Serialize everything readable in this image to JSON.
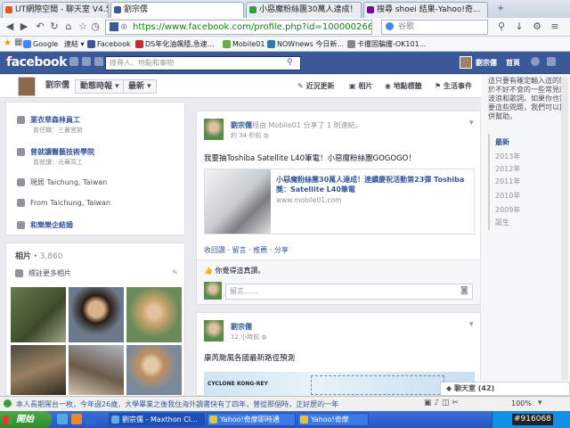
{
  "browser": {
    "tabs": [
      {
        "label": "UT網際空間 - 聊天室 V4.5",
        "color": "#e05a1f"
      },
      {
        "label": "劉宗儒",
        "color": "#3b5998"
      },
      {
        "label": "小惡魔粉絲團30萬人達成！",
        "color": "#3a9d3a"
      },
      {
        "label": "搜尋 shoei 結果-Yahoo!奇...",
        "color": "#7b0099"
      }
    ],
    "url": "https://www.facebook.com/profile.php?id=100000266083152",
    "search_placeholder": "谷歌",
    "bookmarks": [
      "Google",
      "連結",
      "Facebook",
      "DS年化油飆穩,急速...",
      "Mobile01",
      "NOWnews 今日新...",
      "卡攫固騙攫-OK101..."
    ]
  },
  "facebook": {
    "logo": "facebook",
    "search_placeholder": "搜尋人、地點和事物",
    "user_name": "劉宗儒",
    "home_label": "首頁"
  },
  "timeline_bar": {
    "name": "劉宗儒",
    "timeline_btn": "動態時報",
    "latest_btn": "最新",
    "links": [
      "近況更新",
      "相片",
      "地點標籤",
      "生活事件"
    ]
  },
  "about": {
    "items": [
      {
        "title": "業衣草森林員工",
        "sub": "曾任職：三叢宮旅"
      },
      {
        "title": "曾就讀醫藝技術學院",
        "sub": "曾就讀：光華高工"
      },
      {
        "title": "現居 Taichung, Taiwan",
        "sub": ""
      },
      {
        "title": "From Taichung, Taiwan",
        "sub": ""
      },
      {
        "title": "和樂樂企結婚",
        "sub": ""
      }
    ]
  },
  "photos": {
    "title": "相片",
    "count": "3,860",
    "tag_label": "標註更多相片"
  },
  "post1": {
    "name": "劉宗儒",
    "via": "經由 Mobile01 分享了 1 則連結。",
    "time": "約 34 秒前",
    "text": "我要抽Toshiba Satellite L40筆電！小惡魔粉絲團GOGOGO！",
    "link_title": "小惡魔粉絲團30萬人達成！連續慶祝活動第23彈 Toshiba獎：Satellite L40筆電",
    "link_domain": "www.mobile01.com",
    "actions": [
      "收回讚",
      "留言",
      "推薦",
      "分享"
    ],
    "likes": "你覺得這真讚。",
    "comment_placeholder": "留言......"
  },
  "post2": {
    "name": "劉宗儒",
    "time": "12 小時前",
    "text": "康芮颱風各國最新路徑預測",
    "map_label": "CYCLONE KONG-REY"
  },
  "right_column": {
    "ad_text": "這只要有確定輸入這的關於不好不會的一些常見的波浪和歌詞。如果你也需要這些問題，我們可以提供幫助。",
    "years": [
      "最新",
      "2013年",
      "2012年",
      "2011年",
      "2010年",
      "2009年",
      "誕生"
    ],
    "chat_label": "聊天室 (42)"
  },
  "statusbar": {
    "ticker": "本人長期駕台一枚，今年過26歲，大學畢業之後我住海外讀書快有了四年，曾從那個時，正好歷的一年",
    "zoom": "100%"
  },
  "taskbar": {
    "start": "開始",
    "items": [
      "劉宗儒 - Maxthon Cl...",
      "Yahoo!奇摩即時通",
      "Yahoo!奇摩"
    ],
    "time": "#916068"
  }
}
